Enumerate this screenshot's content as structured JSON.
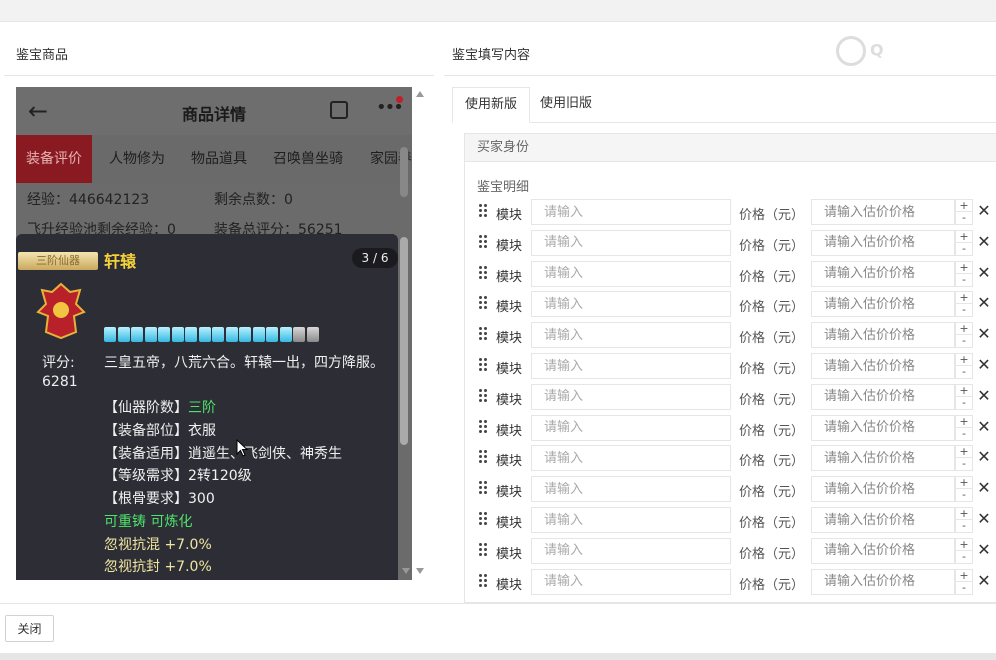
{
  "left_panel": {
    "title": "鉴宝商品"
  },
  "right_panel": {
    "title": "鉴宝填写内容"
  },
  "watermark": "Q",
  "phone": {
    "header_title": "商品详情",
    "back_icon": "arrow-left-icon",
    "share_icon": "share-icon",
    "more_icon": "more-icon",
    "tabs": [
      "装备评价",
      "人物修为",
      "物品道具",
      "召唤兽坐骑",
      "家园养"
    ],
    "active_tab": "装备评价",
    "stats": {
      "exp": "经验：446642123",
      "remaining_points": "剩余点数：0",
      "pool_exp": "飞升经验池剩余经验：0",
      "equip_score": "装备总评分：56251"
    },
    "item_card": {
      "badge": "三阶仙器",
      "name": "轩辕",
      "page": "3 / 6",
      "gems_total": 16,
      "gems_lit": 14,
      "score_label": "评分:",
      "score_value": "6281",
      "description": "三皇五帝，八荒六合。轩辕一出，四方降服。",
      "attrs": [
        {
          "label": "【仙器阶数】",
          "value": "三阶",
          "value_color": "green"
        },
        {
          "label": "【装备部位】",
          "value": "衣服",
          "value_color": "white"
        },
        {
          "label": "【装备适用】",
          "value": "逍遥生、飞剑侠、神秀生",
          "value_color": "white"
        },
        {
          "label": "【等级需求】",
          "value": "2转120级",
          "value_color": "white"
        },
        {
          "label": "【根骨要求】",
          "value": "300",
          "value_color": "white"
        }
      ],
      "recast": "可重铸 可炼化",
      "bonuses": [
        "忽视抗混 +7.0%",
        "忽视抗封 +7.0%"
      ]
    }
  },
  "tabs": [
    {
      "label": "使用新版",
      "active": true
    },
    {
      "label": "使用旧版",
      "active": false
    }
  ],
  "form": {
    "buyer_identity": "买家身份",
    "detail_label": "鉴宝明细",
    "rows": [
      {
        "module_label": "模块",
        "module_placeholder": "请输入",
        "price_label": "价格（元）",
        "price_placeholder": "请输入估价价格",
        "plus": "+",
        "minus": "-"
      },
      {
        "module_label": "模块",
        "module_placeholder": "请输入",
        "price_label": "价格（元）",
        "price_placeholder": "请输入估价价格",
        "plus": "+",
        "minus": "-"
      },
      {
        "module_label": "模块",
        "module_placeholder": "请输入",
        "price_label": "价格（元）",
        "price_placeholder": "请输入估价价格",
        "plus": "+",
        "minus": "-"
      },
      {
        "module_label": "模块",
        "module_placeholder": "请输入",
        "price_label": "价格（元）",
        "price_placeholder": "请输入估价价格",
        "plus": "+",
        "minus": "-"
      },
      {
        "module_label": "模块",
        "module_placeholder": "请输入",
        "price_label": "价格（元）",
        "price_placeholder": "请输入估价价格",
        "plus": "+",
        "minus": "-"
      },
      {
        "module_label": "模块",
        "module_placeholder": "请输入",
        "price_label": "价格（元）",
        "price_placeholder": "请输入估价价格",
        "plus": "+",
        "minus": "-"
      },
      {
        "module_label": "模块",
        "module_placeholder": "请输入",
        "price_label": "价格（元）",
        "price_placeholder": "请输入估价价格",
        "plus": "+",
        "minus": "-"
      },
      {
        "module_label": "模块",
        "module_placeholder": "请输入",
        "price_label": "价格（元）",
        "price_placeholder": "请输入估价价格",
        "plus": "+",
        "minus": "-"
      },
      {
        "module_label": "模块",
        "module_placeholder": "请输入",
        "price_label": "价格（元）",
        "price_placeholder": "请输入估价价格",
        "plus": "+",
        "minus": "-"
      },
      {
        "module_label": "模块",
        "module_placeholder": "请输入",
        "price_label": "价格（元）",
        "price_placeholder": "请输入估价价格",
        "plus": "+",
        "minus": "-"
      },
      {
        "module_label": "模块",
        "module_placeholder": "请输入",
        "price_label": "价格（元）",
        "price_placeholder": "请输入估价价格",
        "plus": "+",
        "minus": "-"
      },
      {
        "module_label": "模块",
        "module_placeholder": "请输入",
        "price_label": "价格（元）",
        "price_placeholder": "请输入估价价格",
        "plus": "+",
        "minus": "-"
      },
      {
        "module_label": "模块",
        "module_placeholder": "请输入",
        "price_label": "价格（元）",
        "price_placeholder": "请输入估价价格",
        "plus": "+",
        "minus": "-"
      }
    ]
  },
  "footer": {
    "close_label": "关闭"
  },
  "colors": {
    "active_tab_bg": "#8a1a22",
    "card_bg": "#2d2d36",
    "item_name": "#f4d33a",
    "green_text": "#4ee36b",
    "bonus_text": "#f0e6a0"
  }
}
